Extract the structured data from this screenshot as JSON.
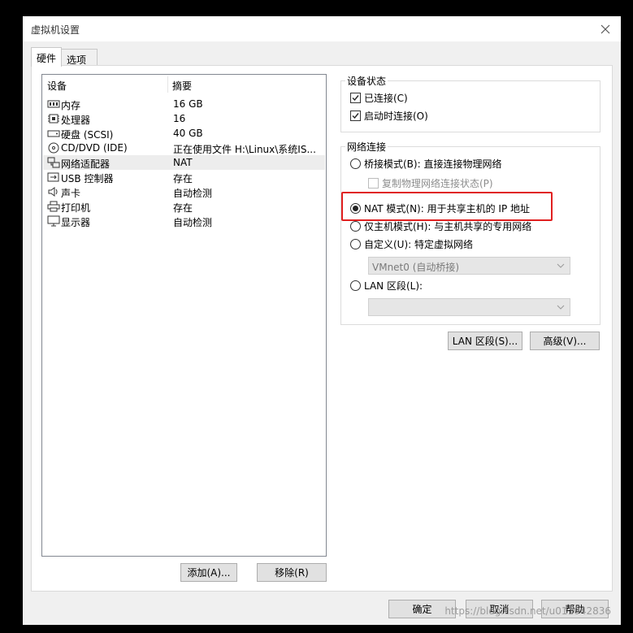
{
  "window": {
    "title": "虚拟机设置",
    "close_icon": "close-icon"
  },
  "tabs": [
    {
      "label": "硬件",
      "active": true
    },
    {
      "label": "选项",
      "active": false
    }
  ],
  "device_list": {
    "headers": {
      "device": "设备",
      "summary": "摘要"
    },
    "rows": [
      {
        "icon": "memory-icon",
        "name": "内存",
        "summary": "16 GB",
        "selected": false
      },
      {
        "icon": "cpu-icon",
        "name": "处理器",
        "summary": "16",
        "selected": false
      },
      {
        "icon": "harddisk-icon",
        "name": "硬盘 (SCSI)",
        "summary": "40 GB",
        "selected": false
      },
      {
        "icon": "cd-dvd-icon",
        "name": "CD/DVD (IDE)",
        "summary": "正在使用文件 H:\\Linux\\系统IS...",
        "selected": false
      },
      {
        "icon": "network-adapter-icon",
        "name": "网络适配器",
        "summary": "NAT",
        "selected": true
      },
      {
        "icon": "usb-icon",
        "name": "USB 控制器",
        "summary": "存在",
        "selected": false
      },
      {
        "icon": "sound-card-icon",
        "name": "声卡",
        "summary": "自动检测",
        "selected": false
      },
      {
        "icon": "printer-icon",
        "name": "打印机",
        "summary": "存在",
        "selected": false
      },
      {
        "icon": "display-icon",
        "name": "显示器",
        "summary": "自动检测",
        "selected": false
      }
    ],
    "add_button": "添加(A)...",
    "remove_button": "移除(R)"
  },
  "device_status": {
    "label": "设备状态",
    "connected": {
      "label": "已连接(C)",
      "checked": true
    },
    "connect_at_power_on": {
      "label": "启动时连接(O)",
      "checked": true
    }
  },
  "network_connection": {
    "label": "网络连接",
    "bridged": {
      "label": "桥接模式(B): 直接连接物理网络",
      "selected": false
    },
    "replicate_state": {
      "label": "复制物理网络连接状态(P)",
      "checked": false,
      "disabled": true
    },
    "nat": {
      "label": "NAT 模式(N): 用于共享主机的 IP 地址",
      "selected": true
    },
    "host_only": {
      "label": "仅主机模式(H): 与主机共享的专用网络",
      "selected": false
    },
    "custom": {
      "label": "自定义(U): 特定虚拟网络",
      "selected": false
    },
    "custom_select": {
      "value": "VMnet0 (自动桥接)"
    },
    "lan_segment": {
      "label": "LAN 区段(L):",
      "selected": false
    },
    "lan_select": {
      "value": ""
    }
  },
  "buttons": {
    "lan_segments": "LAN 区段(S)...",
    "advanced": "高级(V)...",
    "ok": "确定",
    "cancel": "取消",
    "help": "帮助"
  },
  "watermark": "https://blog.csdn.net/u011042836",
  "colors": {
    "highlight_box": "#e02020",
    "selected_row": "#ededed",
    "button_bg": "#e1e1e1"
  }
}
